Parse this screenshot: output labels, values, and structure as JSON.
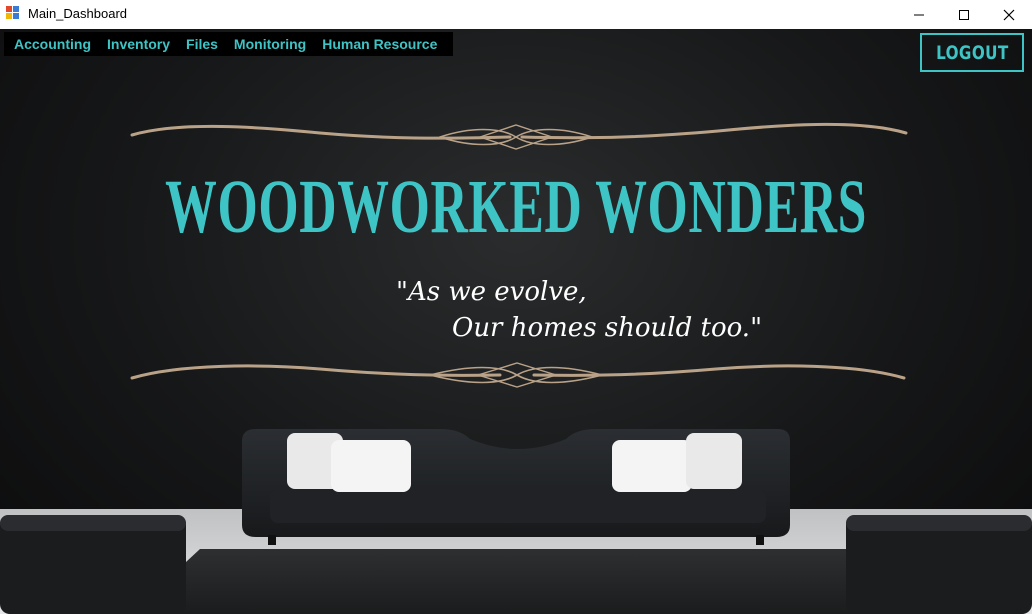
{
  "window": {
    "title": "Main_Dashboard"
  },
  "menu": {
    "items": [
      {
        "label": "Accounting"
      },
      {
        "label": "Inventory"
      },
      {
        "label": "Files"
      },
      {
        "label": "Monitoring"
      },
      {
        "label": "Human Resource"
      }
    ]
  },
  "logout": {
    "label": "LOGOUT"
  },
  "hero": {
    "brand": "WOODWORKED WONDERS",
    "tagline_line1": "\"As we evolve,",
    "tagline_line2": "Our homes should too.\""
  },
  "colors": {
    "accent": "#3fc4c6",
    "ornament": "#b9a288",
    "background": "#141516"
  },
  "icons": [
    "app-icon",
    "minimize-icon",
    "maximize-icon",
    "close-icon"
  ]
}
